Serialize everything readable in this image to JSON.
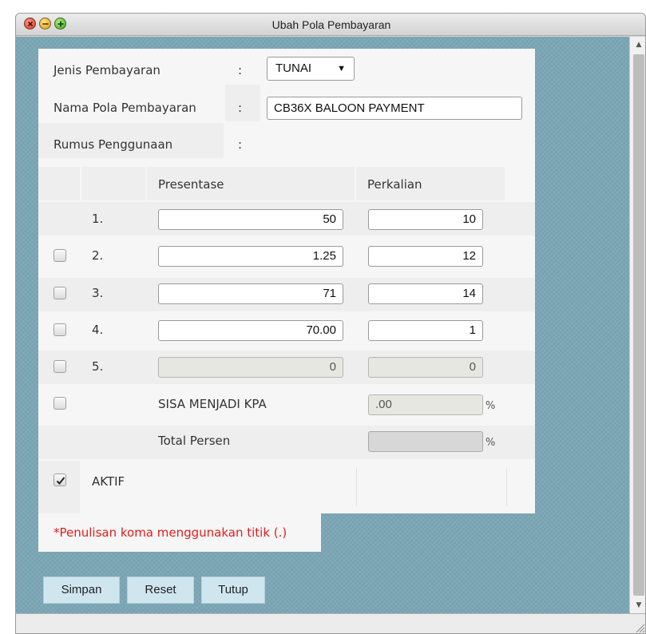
{
  "window": {
    "title": "Ubah Pola Pembayaran"
  },
  "form": {
    "jenis_label": "Jenis Pembayaran",
    "nama_label": "Nama Pola Pembayaran",
    "rumus_label": "Rumus Penggunaan",
    "colon": ":",
    "jenis_value": "TUNAI",
    "nama_value": "CB36X BALOON PAYMENT"
  },
  "table": {
    "col_presentase": "Presentase",
    "col_perkalian": "Perkalian",
    "rows": [
      {
        "num": "1.",
        "presentase": "50",
        "perkalian": "10",
        "checked": false,
        "has_checkbox": false,
        "disabled": false
      },
      {
        "num": "2.",
        "presentase": "1.25",
        "perkalian": "12",
        "checked": false,
        "has_checkbox": true,
        "disabled": false
      },
      {
        "num": "3.",
        "presentase": "71",
        "perkalian": "14",
        "checked": false,
        "has_checkbox": true,
        "disabled": false
      },
      {
        "num": "4.",
        "presentase": "70.00",
        "perkalian": "1",
        "checked": false,
        "has_checkbox": true,
        "disabled": false
      },
      {
        "num": "5.",
        "presentase": "0",
        "perkalian": "0",
        "checked": false,
        "has_checkbox": true,
        "disabled": true
      }
    ],
    "sisa_label": "SISA MENJADI KPA",
    "sisa_value": ".00",
    "total_label": "Total Persen",
    "total_value": "",
    "percent": "%",
    "aktif_label": "AKTIF",
    "aktif_checked": true
  },
  "note": "*Penulisan koma menggunakan titik (.)",
  "buttons": {
    "simpan": "Simpan",
    "reset": "Reset",
    "tutup": "Tutup"
  }
}
